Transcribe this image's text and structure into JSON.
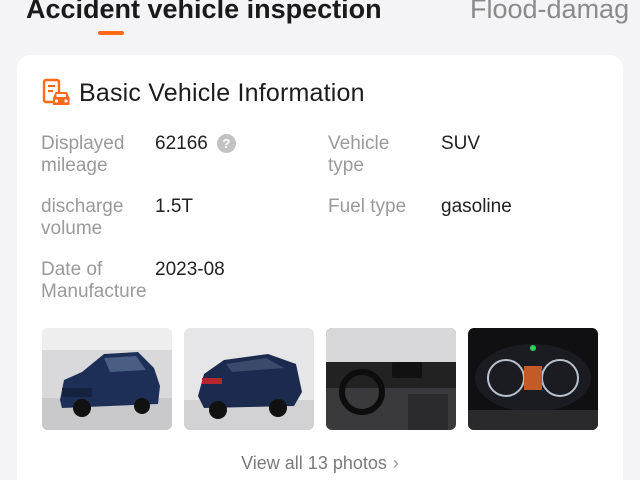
{
  "tabs": [
    {
      "label": "Accident vehicle inspection",
      "active": true
    },
    {
      "label": "Flood-damag",
      "active": false
    }
  ],
  "accent_color": "#ff6a1a",
  "card": {
    "icon": "car-document-icon",
    "title": "Basic Vehicle Information",
    "fields": {
      "mileage": {
        "label_line1": "Displayed",
        "label_line2": "mileage",
        "value": "62166",
        "help_icon": "question-circle-icon",
        "help_glyph": "?"
      },
      "vehicle_type": {
        "label_line1": "Vehicle",
        "label_line2": "type",
        "value": "SUV"
      },
      "displacement": {
        "label_line1": "discharge",
        "label_line2": "volume",
        "value": "1.5T"
      },
      "fuel_type": {
        "label": "Fuel type",
        "value": "gasoline"
      },
      "manufacture_date": {
        "label_line1": "Date of",
        "label_line2": "Manufacture",
        "value": "2023-08"
      }
    },
    "photos": [
      "car-front-exterior-photo",
      "car-rear-exterior-photo",
      "car-interior-dashboard-photo",
      "car-instrument-cluster-photo"
    ],
    "view_all_label": "View all 13 photos",
    "view_all_icon": "chevron-right-icon",
    "view_all_glyph": "›"
  }
}
